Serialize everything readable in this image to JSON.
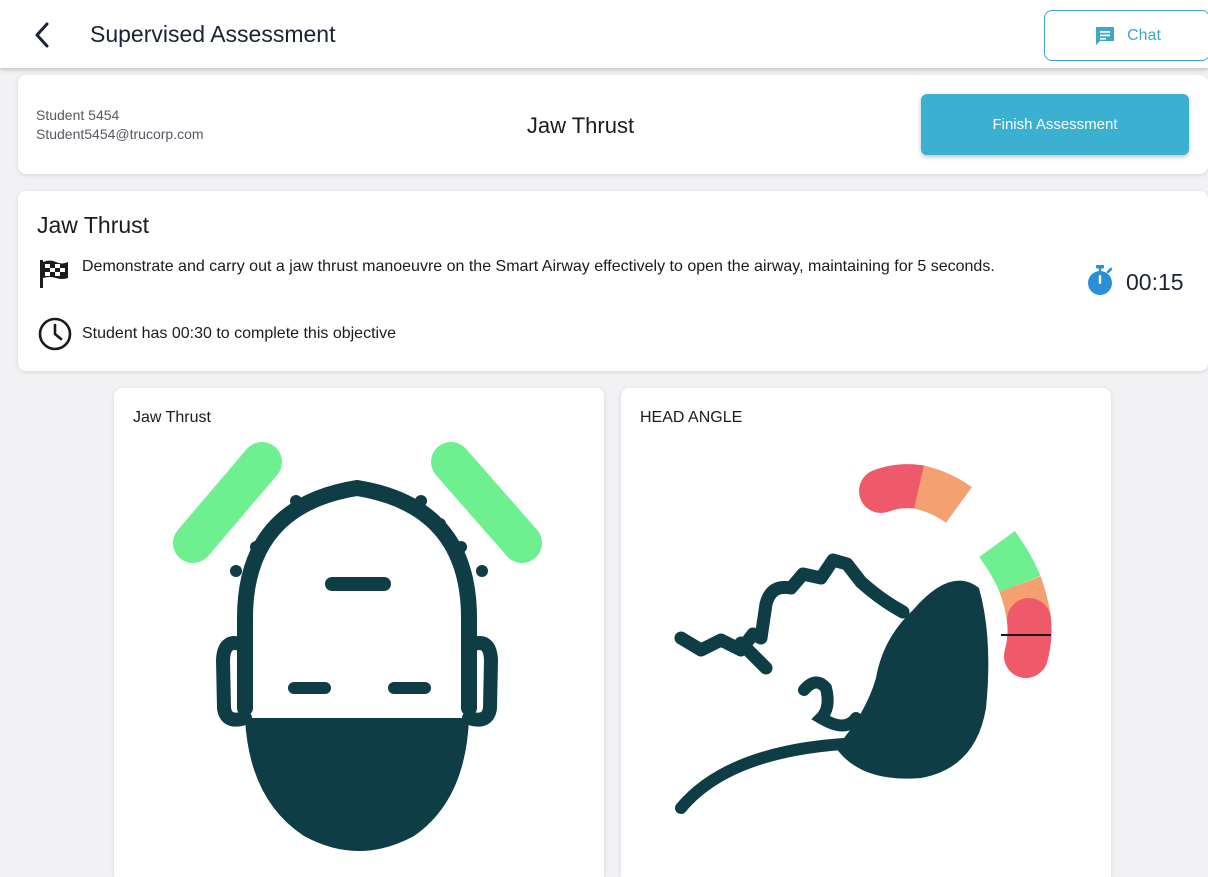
{
  "header": {
    "title": "Supervised Assessment",
    "back_icon": "chevron-left-icon",
    "chat_label": "Chat",
    "chat_icon": "chat-icon",
    "accent_color": "#3fa7cc"
  },
  "student": {
    "name": "Student 5454",
    "email": "Student5454@trucorp.com",
    "task_title": "Jaw Thrust",
    "finish_label": "Finish Assessment",
    "finish_color": "#3bb0d1"
  },
  "objective": {
    "heading": "Jaw Thrust",
    "description": "Demonstrate and carry out a jaw thrust manoeuvre on the Smart Airway effectively to open the airway, maintaining for 5 seconds.",
    "time_limit_text": "Student has 00:30 to complete this objective",
    "timer_value": "00:15",
    "flag_icon": "checkered-flag-icon",
    "clock_icon": "clock-icon",
    "timer_icon": "stopwatch-icon",
    "timer_color": "#2b8fd6"
  },
  "panels": [
    {
      "label": "Jaw Thrust",
      "icon": "jaw-thrust-head-illustration",
      "indicator_color": "#6ef090"
    },
    {
      "label": "HEAD ANGLE",
      "icon": "head-angle-gauge-illustration"
    }
  ],
  "colors": {
    "figure": "#0f3d45",
    "gauge_red": "#ef5a6a",
    "gauge_orange": "#f5a070",
    "gauge_green": "#6ef090"
  }
}
